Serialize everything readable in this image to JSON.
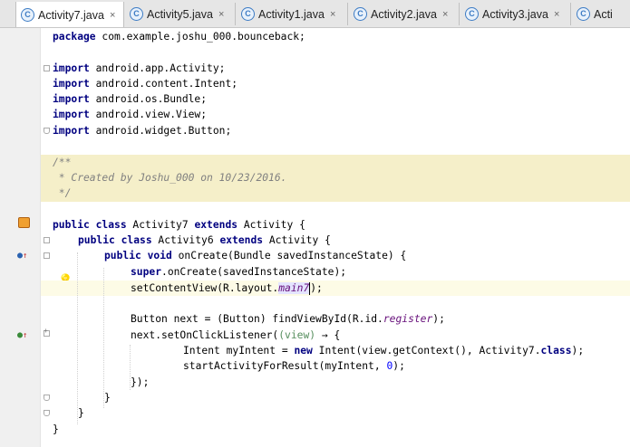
{
  "tabs": [
    {
      "label": "Activity7.java",
      "active": true
    },
    {
      "label": "Activity5.java",
      "active": false
    },
    {
      "label": "Activity1.java",
      "active": false
    },
    {
      "label": "Activity2.java",
      "active": false
    },
    {
      "label": "Activity3.java",
      "active": false
    },
    {
      "label": "Acti",
      "active": false
    }
  ],
  "tab_close_glyph": "×",
  "tab_icon_letter": "C",
  "code": {
    "package_kw": "package",
    "package_name": " com.example.joshu_000.bounceback;",
    "import_kw": "import",
    "imports": [
      " android.app.Activity;",
      " android.content.Intent;",
      " android.os.Bundle;",
      " android.view.View;",
      " android.widget.Button;"
    ],
    "comment": [
      "/**",
      " * Created by Joshu_000 on 10/23/2016.",
      " */"
    ],
    "class_line": {
      "kw1": "public class",
      "name": " Activity7 ",
      "kw2": "extends",
      "rest": " Activity {"
    },
    "inner_line": {
      "kw1": "public class",
      "name": " Activity6 ",
      "kw2": "extends",
      "rest": " Activity {"
    },
    "oncreate_line": {
      "kw1": "public void",
      "rest": " onCreate(Bundle savedInstanceState) {"
    },
    "super_line": {
      "kw": "super",
      "rest": ".onCreate(savedInstanceState);"
    },
    "setcontent_line": {
      "pre": "setContentView(R.layout.",
      "field": "main7",
      "post": ");"
    },
    "button_line": {
      "pre": "Button next = (Button) findViewById(R.id.",
      "field": "register",
      "post": ");"
    },
    "listener_line": {
      "pre": "next.setOnClickListener(",
      "param": "(view)",
      "arrow": " → {"
    },
    "intent_line": {
      "pre": "Intent myIntent = ",
      "kw": "new",
      "mid": " Intent(view.getContext(), Activity7.",
      "kw2": "class",
      "post": ");"
    },
    "start_line": {
      "pre": "startActivityForResult(myIntent, ",
      "num": "0",
      "post": ");"
    },
    "close_listener": "});",
    "brace": "}"
  },
  "colors": {
    "keyword": "#000080",
    "comment": "#808080",
    "number": "#0000ff",
    "field": "#660e7a",
    "comment_bg": "#f5efc9"
  },
  "gutter_icons": [
    "activity-layout-icon",
    "override-method-icon",
    "intention-bulb-icon",
    "implement-icon"
  ]
}
